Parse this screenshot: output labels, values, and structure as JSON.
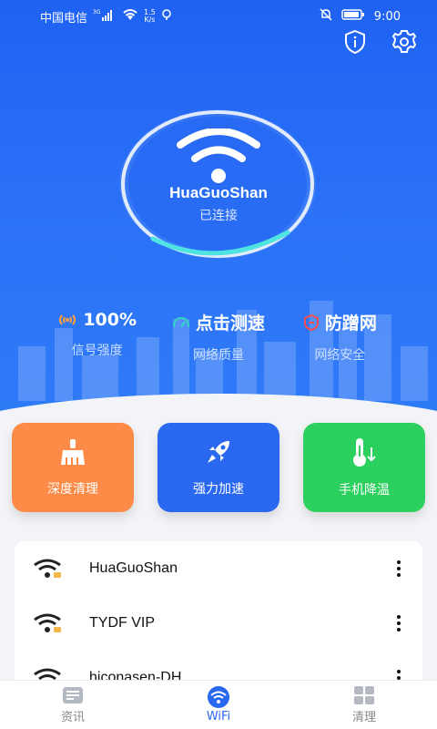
{
  "status": {
    "carrier": "中国电信",
    "network_type": "3G",
    "speed_value": "1.5",
    "speed_unit": "K/s",
    "time": "9:00"
  },
  "header": {
    "info_icon": "shield-info-icon",
    "settings_icon": "gear-icon"
  },
  "connection": {
    "ssid": "HuaGuoShan",
    "state": "已连接"
  },
  "stats": [
    {
      "value": "100%",
      "label": "信号强度",
      "icon": "signal-icon",
      "color": "#ff9f3a"
    },
    {
      "value": "点击测速",
      "label": "网络质量",
      "icon": "speed-gauge-icon",
      "color": "#33d6c0"
    },
    {
      "value": "防蹭网",
      "label": "网络安全",
      "icon": "shield-icon",
      "color": "#ff4b4b"
    }
  ],
  "actions": [
    {
      "label": "深度清理",
      "icon": "broom-icon",
      "color": "#fd8b47"
    },
    {
      "label": "强力加速",
      "icon": "rocket-icon",
      "color": "#2a68f0"
    },
    {
      "label": "手机降温",
      "icon": "thermometer-icon",
      "color": "#2bd05e"
    }
  ],
  "networks": [
    {
      "name": "HuaGuoShan"
    },
    {
      "name": "TYDF VIP"
    },
    {
      "name": "hiconasen-DH"
    }
  ],
  "nav": {
    "items": [
      {
        "label": "资讯",
        "icon": "news-icon"
      },
      {
        "label": "WiFi",
        "icon": "wifi-icon"
      },
      {
        "label": "清理",
        "icon": "grid-icon"
      }
    ],
    "active_index": 1
  }
}
